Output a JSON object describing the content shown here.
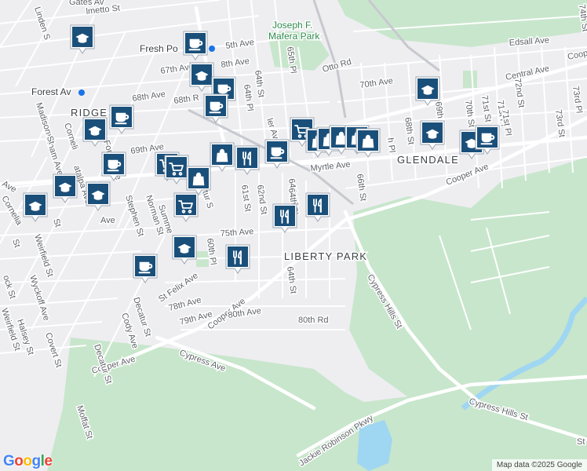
{
  "map": {
    "attribution": "Map data ©2025 Google",
    "logo_letters": [
      "G",
      "o",
      "o",
      "g",
      "l",
      "e"
    ],
    "pin_color": "#1a4f7a",
    "water_color": "#9fd6f2",
    "park_color": "#c8e6cc"
  },
  "neighborhoods": [
    {
      "id": "glendale",
      "text": "GLENDALE"
    },
    {
      "id": "liberty-park",
      "text": "LIBERTY PARK"
    },
    {
      "id": "ridgewood",
      "text": "RIDGE"
    }
  ],
  "parks": [
    {
      "id": "mafera-park-1",
      "text": "Joseph F."
    },
    {
      "id": "mafera-park-2",
      "text": "Mafera Park"
    }
  ],
  "places": [
    {
      "id": "fresh-pond",
      "text": "Fresh Po"
    },
    {
      "id": "forest-ave",
      "text": "Forest Av"
    }
  ],
  "streets": [
    {
      "id": "myrtle-ave",
      "text": "Myrtle Ave"
    },
    {
      "id": "central-ave",
      "text": "Central Ave"
    },
    {
      "id": "cooper-ave-e",
      "text": "Cooper Ave"
    },
    {
      "id": "cooper-ave-sw",
      "text": "Cooper Ave"
    },
    {
      "id": "cooper-ave-mid",
      "text": "Cooper Ave"
    },
    {
      "id": "cypress-ave",
      "text": "Cypress Ave"
    },
    {
      "id": "cypress-hills-st",
      "text": "Cypress Hills St"
    },
    {
      "id": "cypress-hills-st-2",
      "text": "Cypress Hills St"
    },
    {
      "id": "jackie-robinson",
      "text": "Jackie Robinson Pkwy"
    },
    {
      "id": "edsall-ave",
      "text": "Edsall Ave"
    },
    {
      "id": "otto-rd",
      "text": "Otto Rd"
    },
    {
      "id": "70th-ave",
      "text": "70th Ave"
    },
    {
      "id": "69th-ave",
      "text": "69th Ave"
    },
    {
      "id": "68th-ave",
      "text": "68th Ave"
    },
    {
      "id": "68th-rd",
      "text": "68th R"
    },
    {
      "id": "67th-ave",
      "text": "67th Ave"
    },
    {
      "id": "75th-ave",
      "text": "75th Ave"
    },
    {
      "id": "78th-ave",
      "text": "78th Ave"
    },
    {
      "id": "79th-ave",
      "text": "79th Ave"
    },
    {
      "id": "80th-ave",
      "text": "80th Ave"
    },
    {
      "id": "80th-rd",
      "text": "80th Rd"
    },
    {
      "id": "65th-pl",
      "text": "65th Pl"
    },
    {
      "id": "64th-st-n",
      "text": "64th St"
    },
    {
      "id": "64th-pl-n",
      "text": "64th Pl"
    },
    {
      "id": "64th-pl-s",
      "text": "64th Pl"
    },
    {
      "id": "64th-st-s",
      "text": "64th St"
    },
    {
      "id": "62nd-st",
      "text": "62nd St"
    },
    {
      "id": "61st-st",
      "text": "61st St"
    },
    {
      "id": "60th-pl",
      "text": "60th Pl"
    },
    {
      "id": "66th-st",
      "text": "66th St"
    },
    {
      "id": "68th-st",
      "text": "68th St"
    },
    {
      "id": "69th-st",
      "text": "69th St"
    },
    {
      "id": "70th-st",
      "text": "70th St"
    },
    {
      "id": "71st-st",
      "text": "71st St"
    },
    {
      "id": "71st-pl",
      "text": "71st Pl"
    },
    {
      "id": "72nd-st",
      "text": "72nd St"
    },
    {
      "id": "73rd-st",
      "text": "73rd St"
    },
    {
      "id": "73rd-pl",
      "text": "73rd Pl"
    },
    {
      "id": "74th-st",
      "text": "74th St"
    },
    {
      "id": "stephen-st",
      "text": "Stephen St"
    },
    {
      "id": "norman-st",
      "text": "Norman St"
    },
    {
      "id": "summerfield",
      "text": "Summe"
    },
    {
      "id": "catalpa",
      "text": "atalpa Ave"
    },
    {
      "id": "cornelia-n",
      "text": "Corneli"
    },
    {
      "id": "cornelia-s",
      "text": "Cornelia"
    },
    {
      "id": "putnam",
      "text": "Putnam Ave"
    },
    {
      "id": "madison",
      "text": "Madison St"
    },
    {
      "id": "linden",
      "text": "Linden S"
    },
    {
      "id": "gates",
      "text": "Gates Av"
    },
    {
      "id": "palmetto",
      "text": "lmetto St"
    },
    {
      "id": "st-felix",
      "text": "St Felix Ave"
    },
    {
      "id": "cody",
      "text": "Cody Ave"
    },
    {
      "id": "decatur-1",
      "text": "Decatur St"
    },
    {
      "id": "decatur-2",
      "text": "Decatur St"
    },
    {
      "id": "covert",
      "text": "Covert St"
    },
    {
      "id": "halsey",
      "text": "Halsey St"
    },
    {
      "id": "weirfield-1",
      "text": "Weirfield St"
    },
    {
      "id": "weirfield-2",
      "text": "Weirfield St"
    },
    {
      "id": "wyckoff",
      "text": "Wyckoff Ave"
    },
    {
      "id": "moffat",
      "text": "Moffat St"
    },
    {
      "id": "bleecker",
      "text": "ler Ave"
    },
    {
      "id": "st-2",
      "text": "St"
    },
    {
      "id": "st-3",
      "text": "St"
    },
    {
      "id": "stockholm",
      "text": "ock St"
    },
    {
      "id": "ave-w",
      "text": "Ave"
    },
    {
      "id": "ave-w2",
      "text": "Ave"
    },
    {
      "id": "ave-cooper-edge",
      "text": "Coop"
    },
    {
      "id": "forest-ave-side",
      "text": "Forest Ave"
    },
    {
      "id": "68th-pl",
      "text": "h Pl"
    },
    {
      "id": "71st-pl-2",
      "text": "71st Pl"
    },
    {
      "id": "st-edge",
      "text": "St"
    },
    {
      "id": "5th-ave",
      "text": "5th Ave"
    },
    {
      "id": "8th-ave",
      "text": "8th Ave"
    },
    {
      "id": "64th-pl-mid",
      "text": "64th Pl"
    },
    {
      "id": "tur",
      "text": "tur S"
    }
  ],
  "pins": [
    {
      "id": "school-1",
      "category": "school",
      "icon": "graduation-cap-icon"
    },
    {
      "id": "cafe-1",
      "category": "cafe",
      "icon": "coffee-cup-icon"
    },
    {
      "id": "school-2",
      "category": "school",
      "icon": "graduation-cap-icon"
    },
    {
      "id": "cafe-2",
      "category": "cafe",
      "icon": "coffee-cup-icon"
    },
    {
      "id": "cafe-3",
      "category": "cafe",
      "icon": "coffee-cup-icon"
    },
    {
      "id": "cafe-4",
      "category": "cafe",
      "icon": "coffee-cup-icon"
    },
    {
      "id": "school-3",
      "category": "school",
      "icon": "graduation-cap-icon"
    },
    {
      "id": "cafe-5",
      "category": "cafe",
      "icon": "coffee-cup-icon"
    },
    {
      "id": "grocery-1",
      "category": "grocery",
      "icon": "shopping-cart-icon"
    },
    {
      "id": "grocery-2",
      "category": "grocery",
      "icon": "shopping-cart-icon"
    },
    {
      "id": "shop-1",
      "category": "shopping",
      "icon": "shopping-bag-icon"
    },
    {
      "id": "shop-2",
      "category": "shopping",
      "icon": "shopping-bag-icon"
    },
    {
      "id": "restaurant-1",
      "category": "restaurant",
      "icon": "fork-knife-icon"
    },
    {
      "id": "cafe-6",
      "category": "cafe",
      "icon": "coffee-cup-icon"
    },
    {
      "id": "grocery-3",
      "category": "grocery",
      "icon": "shopping-cart-icon"
    },
    {
      "id": "shop-3",
      "category": "shopping",
      "icon": "shopping-bag-icon"
    },
    {
      "id": "shop-4",
      "category": "shopping",
      "icon": "shopping-bag-icon"
    },
    {
      "id": "shop-5",
      "category": "shopping",
      "icon": "shopping-bag-icon"
    },
    {
      "id": "shop-6",
      "category": "shopping",
      "icon": "shopping-bag-icon"
    },
    {
      "id": "shop-7",
      "category": "shopping",
      "icon": "shopping-bag-icon"
    },
    {
      "id": "school-4",
      "category": "school",
      "icon": "graduation-cap-icon"
    },
    {
      "id": "school-5",
      "category": "school",
      "icon": "graduation-cap-icon"
    },
    {
      "id": "school-6",
      "category": "school",
      "icon": "graduation-cap-icon"
    },
    {
      "id": "cafe-7",
      "category": "cafe",
      "icon": "coffee-cup-icon"
    },
    {
      "id": "school-7",
      "category": "school",
      "icon": "graduation-cap-icon"
    },
    {
      "id": "school-8",
      "category": "school",
      "icon": "graduation-cap-icon"
    },
    {
      "id": "school-9",
      "category": "school",
      "icon": "graduation-cap-icon"
    },
    {
      "id": "grocery-4",
      "category": "grocery",
      "icon": "shopping-cart-icon"
    },
    {
      "id": "restaurant-2",
      "category": "restaurant",
      "icon": "fork-knife-icon"
    },
    {
      "id": "restaurant-3",
      "category": "restaurant",
      "icon": "fork-knife-icon"
    },
    {
      "id": "restaurant-4",
      "category": "restaurant",
      "icon": "fork-knife-icon"
    },
    {
      "id": "school-10",
      "category": "school",
      "icon": "graduation-cap-icon"
    },
    {
      "id": "cafe-8",
      "category": "cafe",
      "icon": "coffee-cup-icon"
    }
  ]
}
